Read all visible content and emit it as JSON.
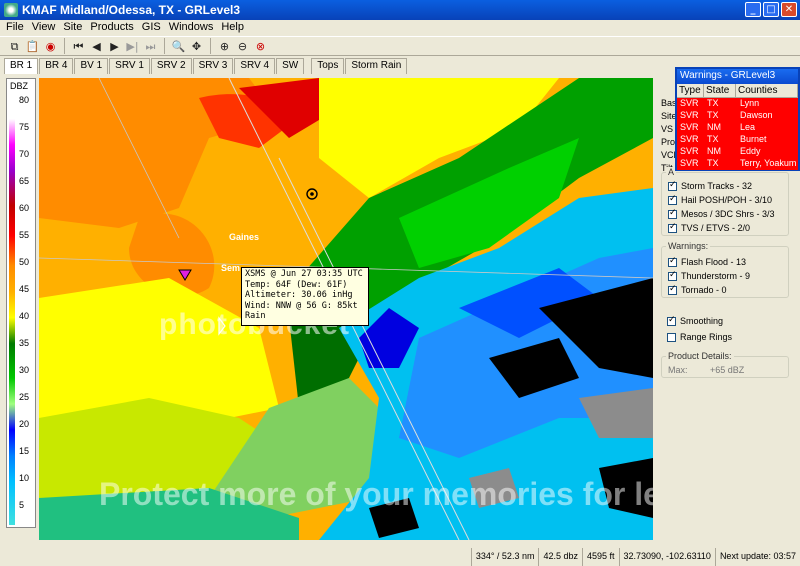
{
  "window": {
    "title": "KMAF Midland/Odessa, TX - GRLevel3",
    "min": "_",
    "max": "□",
    "close": "✕"
  },
  "menu": [
    "File",
    "View",
    "Site",
    "Products",
    "GIS",
    "Windows",
    "Help"
  ],
  "toolbar": {
    "icons": [
      "copy-icon",
      "paste-icon",
      "radar-icon",
      "first-frame-icon",
      "prev-frame-icon",
      "play-icon",
      "next-frame-icon",
      "last-frame-icon",
      "zoom-icon",
      "pan-icon",
      "zoom-in-icon",
      "zoom-out-icon",
      "zoom-reset-icon"
    ],
    "glyphs": [
      "⧉",
      "📋",
      "◉",
      "⏮",
      "◀",
      "▶",
      "▶|",
      "⏭",
      "🔍",
      "✥",
      "⊕",
      "⊖",
      "⊗"
    ]
  },
  "tabs": [
    "BR 1",
    "BR 4",
    "BV 1",
    "SRV 1",
    "SRV 2",
    "SRV 3",
    "SRV 4",
    "SW",
    "Tops",
    "Storm Rain"
  ],
  "legend": {
    "title": "DBZ",
    "labels": [
      "80",
      "75",
      "70",
      "65",
      "60",
      "55",
      "50",
      "45",
      "40",
      "35",
      "30",
      "25",
      "20",
      "15",
      "10",
      "5"
    ]
  },
  "map": {
    "watermark_top": "photobucket",
    "watermark_bottom": "Protect more of your memories for less!",
    "labels": {
      "city1": "Gaines",
      "city2": "Sem"
    },
    "tooltip": [
      "XSMS @ Jun 27 03:35 UTC",
      "Temp: 64F (Dew: 61F)",
      " Altimeter: 30.06 inHg",
      "Wind: NNW @ 56 G: 85kt",
      " Rain"
    ]
  },
  "warnings": {
    "title": "Warnings - GRLevel3",
    "headers": [
      "Type",
      "State",
      "Counties"
    ],
    "rows": [
      {
        "type": "SVR",
        "state": "TX",
        "county": "Lynn"
      },
      {
        "type": "SVR",
        "state": "TX",
        "county": "Dawson"
      },
      {
        "type": "SVR",
        "state": "NM",
        "county": "Lea"
      },
      {
        "type": "SVR",
        "state": "TX",
        "county": "Burnet"
      },
      {
        "type": "SVR",
        "state": "NM",
        "county": "Eddy"
      },
      {
        "type": "SVR",
        "state": "TX",
        "county": "Terry, Yoakum"
      }
    ]
  },
  "side": {
    "partial": [
      "Bas",
      "Site",
      "VS",
      "Pro",
      "VCP",
      "Tilt"
    ],
    "a_title": "A",
    "a_items": [
      {
        "label": "Storm Tracks - 32",
        "on": true
      },
      {
        "label": "Hail POSH/POH - 3/10",
        "on": true
      },
      {
        "label": "Mesos / 3DC Shrs - 3/3",
        "on": true
      },
      {
        "label": "TVS / ETVS - 2/0",
        "on": true
      }
    ],
    "warnings_title": "Warnings:",
    "warnings_items": [
      {
        "label": "Flash Flood - 13",
        "on": true
      },
      {
        "label": "Thunderstorm - 9",
        "on": true
      },
      {
        "label": "Tornado - 0",
        "on": true
      }
    ],
    "smoothing": "Smoothing",
    "range_rings": "Range Rings",
    "product_title": "Product Details:",
    "max_label": "Max:",
    "max_value": "+65 dBZ"
  },
  "status": [
    "334° / 52.3 nm",
    "42.5 dbz",
    "4595 ft",
    "32.73090, -102.63110",
    "Next update: 03:57"
  ],
  "colors": {
    "red": "#ff0000",
    "titlebar": "#0842b8"
  }
}
